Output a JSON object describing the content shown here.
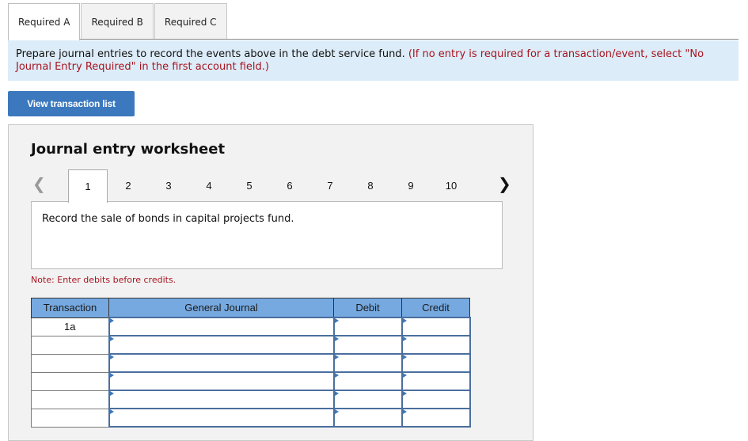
{
  "tabs": [
    {
      "label": "Required A",
      "active": true
    },
    {
      "label": "Required B",
      "active": false
    },
    {
      "label": "Required C",
      "active": false
    }
  ],
  "instructions": {
    "main": "Prepare journal entries to record the events above in the debt service fund.",
    "note": "(If no entry is required for a transaction/event, select \"No Journal Entry Required\" in the first account field.)"
  },
  "view_button_label": "View transaction list",
  "worksheet": {
    "title": "Journal entry worksheet",
    "prev_icon": "chevron-left-icon",
    "next_icon": "chevron-right-icon",
    "pages": [
      "1",
      "2",
      "3",
      "4",
      "5",
      "6",
      "7",
      "8",
      "9",
      "10"
    ],
    "active_page": "1",
    "description": "Record the sale of bonds in capital projects fund.",
    "note": "Note: Enter debits before credits.",
    "table": {
      "headers": {
        "transaction": "Transaction",
        "general_journal": "General Journal",
        "debit": "Debit",
        "credit": "Credit"
      },
      "rows": [
        {
          "transaction": "1a",
          "account": "",
          "debit": "",
          "credit": ""
        },
        {
          "transaction": "",
          "account": "",
          "debit": "",
          "credit": ""
        },
        {
          "transaction": "",
          "account": "",
          "debit": "",
          "credit": ""
        },
        {
          "transaction": "",
          "account": "",
          "debit": "",
          "credit": ""
        },
        {
          "transaction": "",
          "account": "",
          "debit": "",
          "credit": ""
        },
        {
          "transaction": "",
          "account": "",
          "debit": "",
          "credit": ""
        }
      ]
    }
  },
  "colors": {
    "accent_button": "#3b78bd",
    "info_background": "#dcecf8",
    "note_red": "#a8141f",
    "table_header": "#76a9e0",
    "input_border": "#4a6f9e"
  }
}
